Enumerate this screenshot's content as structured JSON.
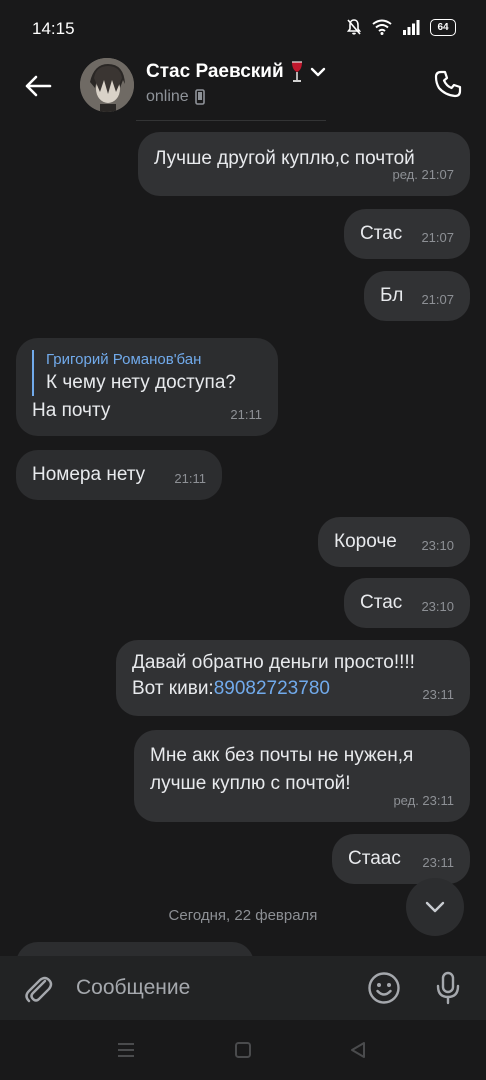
{
  "status_bar": {
    "time": "14:15",
    "battery": "64"
  },
  "header": {
    "contact_name": "Стас Раевский",
    "contact_status": "online"
  },
  "messages": [
    {
      "text": "Лучше другой куплю,с почтой",
      "time": "ред. 21:07"
    },
    {
      "text": "Стас",
      "time": "21:07"
    },
    {
      "text": "Бл",
      "time": "21:07"
    },
    {
      "reply_name": "Григорий Романов'бан",
      "reply_text": "К чему нету доступа?",
      "text": "На почту",
      "time": "21:11"
    },
    {
      "text": "Номера нету",
      "time": "21:11"
    },
    {
      "text": "Короче",
      "time": "23:10"
    },
    {
      "text": "Стас",
      "time": "23:10"
    },
    {
      "line1": "Давай обратно деньги просто!!!!",
      "line2_prefix": "Вот киви:",
      "line2_link": "89082723780",
      "time": "23:11"
    },
    {
      "line1": "Мне акк без почты не нужен,я",
      "line2": "лучше куплю с почтой!",
      "time": "ред. 23:11"
    },
    {
      "text": "Стаас",
      "time": "23:11"
    }
  ],
  "date_separator": "Сегодня, 22 февраля",
  "composer": {
    "placeholder": "Сообщение"
  },
  "icons": {
    "back": "arrow-left-icon",
    "call": "phone-icon",
    "attach": "paperclip-icon",
    "emoji": "smile-icon",
    "mic": "microphone-icon",
    "scroll": "chevron-down-icon"
  },
  "colors": {
    "accent": "#71aaeb",
    "background": "#19191a",
    "bubble": "#2c2d2f"
  }
}
